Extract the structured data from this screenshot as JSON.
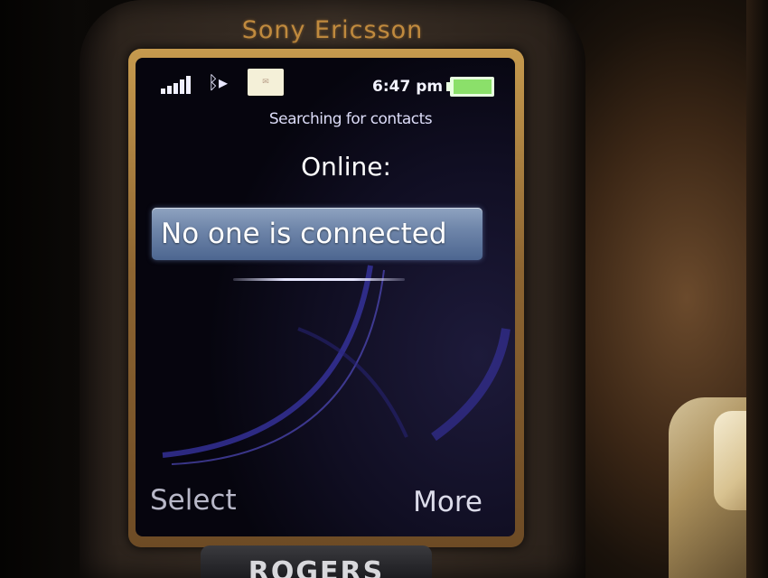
{
  "device": {
    "brand": "Sony Ericsson",
    "carrier": "ROGERS"
  },
  "status_bar": {
    "signal_icon": "signal-bars-icon",
    "bluetooth_icon": "bluetooth-icon",
    "message_icon": "message-icon",
    "time": "6:47 pm",
    "battery_icon": "battery-icon",
    "battery_level": 1.0
  },
  "screen": {
    "status_text": "Searching for contacts",
    "section_title": "Online:",
    "selected_item": "No one is connected"
  },
  "softkeys": {
    "left": "Select",
    "right": "More"
  },
  "colors": {
    "highlight": "#6f86aa",
    "brand_gold": "#c08a3e",
    "battery_green": "#8be06a"
  }
}
